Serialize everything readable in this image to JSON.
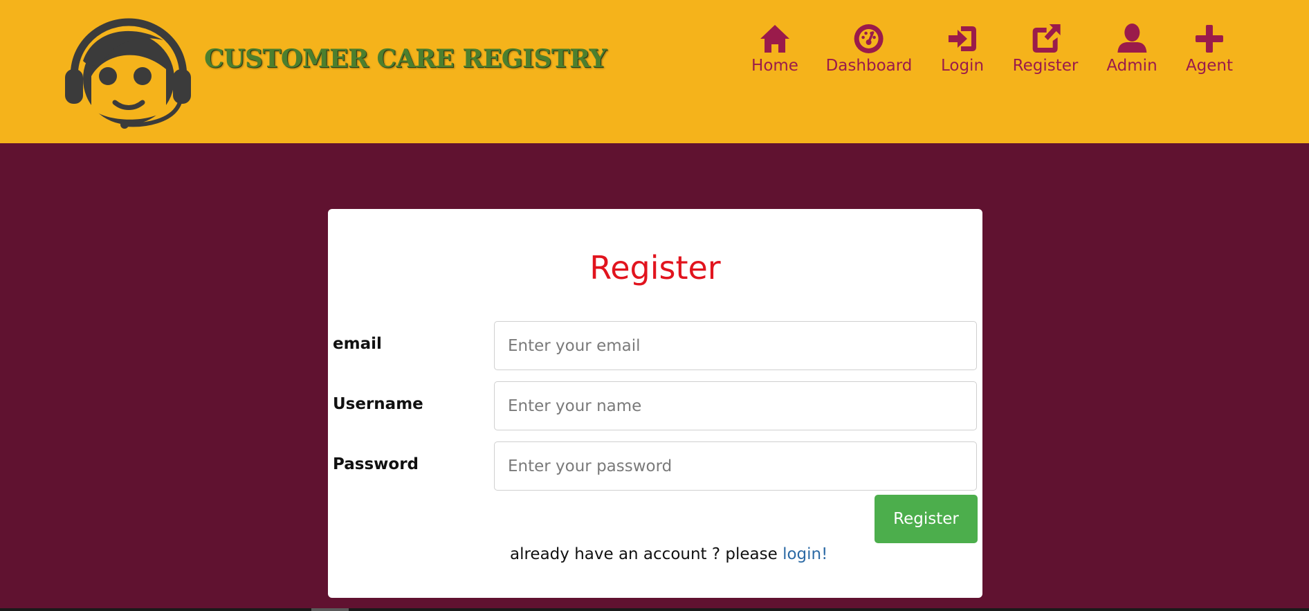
{
  "header": {
    "brand": "CUSTOMER CARE REGISTRY",
    "colors": {
      "background": "#f5b31b",
      "nav_accent": "#9a1b4b",
      "brand_text": "#4c7f2e"
    }
  },
  "nav": [
    {
      "label": "Home",
      "icon": "home-icon"
    },
    {
      "label": "Dashboard",
      "icon": "dashboard-icon"
    },
    {
      "label": "Login",
      "icon": "login-icon"
    },
    {
      "label": "Register",
      "icon": "register-icon"
    },
    {
      "label": "Admin",
      "icon": "user-icon"
    },
    {
      "label": "Agent",
      "icon": "plus-icon"
    }
  ],
  "form": {
    "title": "Register",
    "fields": [
      {
        "label": "email",
        "placeholder": "Enter your email",
        "value": ""
      },
      {
        "label": "Username",
        "placeholder": "Enter your name",
        "value": ""
      },
      {
        "label": "Password",
        "placeholder": "Enter your password",
        "value": ""
      }
    ],
    "submit_label": "Register",
    "footer_text": "already have an account ? please ",
    "footer_link": "login!",
    "colors": {
      "page_background": "#601230",
      "title": "#e1141e",
      "submit": "#4cae4c",
      "link": "#2c6aa5"
    }
  }
}
